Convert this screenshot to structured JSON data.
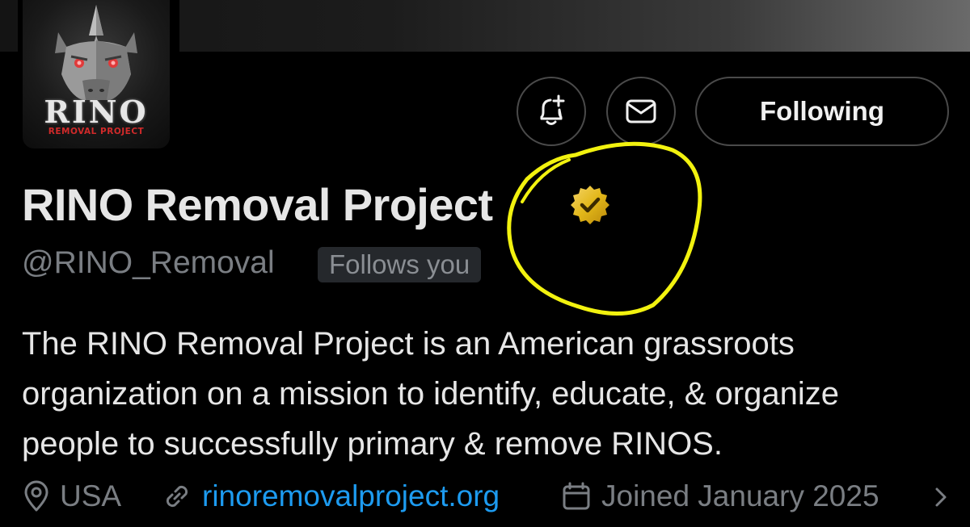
{
  "avatar": {
    "logo_title": "RINO",
    "logo_subtitle": "REMOVAL PROJECT",
    "icon": "rhino-head-icon"
  },
  "actions": {
    "notify_icon": "bell-plus-icon",
    "message_icon": "envelope-icon",
    "follow_label": "Following"
  },
  "profile": {
    "display_name": "RINO Removal Project",
    "verified_icon": "gold-verified-badge-icon",
    "handle": "@RINO_Removal",
    "follows_you": "Follows you",
    "bio_lines": [
      "The RINO Removal Project is an American grassroots",
      "organization on a mission to identify, educate, & organize",
      "people to successfully primary & remove RINOS."
    ],
    "location": "USA",
    "website": "rinoremovalproject.org",
    "joined": "Joined January 2025"
  },
  "colors": {
    "background": "#000000",
    "text_primary": "#e6e6e6",
    "text_secondary": "#7a7e83",
    "link": "#1d9bf0",
    "verified_gold": "#e2b719",
    "annotation_yellow": "#f2f20f"
  }
}
